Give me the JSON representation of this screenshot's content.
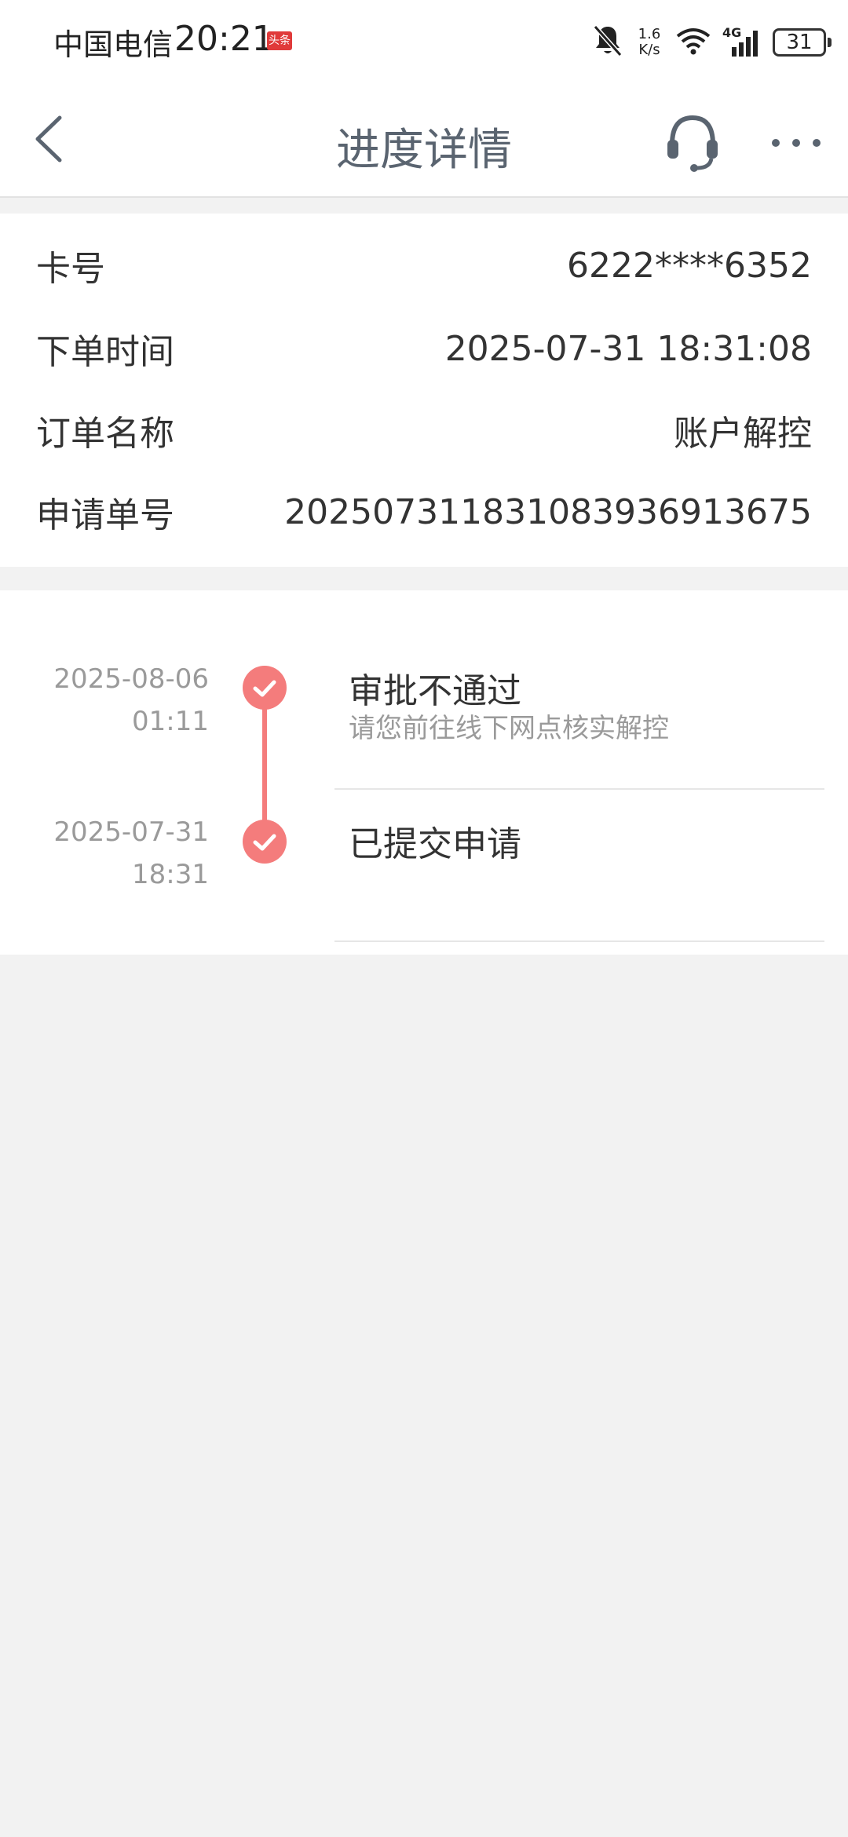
{
  "status_bar": {
    "carrier": "中国电信",
    "time": "20:21",
    "news_badge": "头条",
    "net_speed_value": "1.6",
    "net_speed_unit": "K/s",
    "network_type": "4G",
    "battery": "31"
  },
  "header": {
    "title": "进度详情",
    "back_icon": "chevron-left-icon",
    "support_icon": "headset-icon",
    "more_icon": "more-dots-icon"
  },
  "details": [
    {
      "label": "卡号",
      "value": "6222****6352"
    },
    {
      "label": "下单时间",
      "value": "2025-07-31 18:31:08"
    },
    {
      "label": "订单名称",
      "value": "账户解控"
    },
    {
      "label": "申请单号",
      "value": "202507311831083936913675"
    }
  ],
  "timeline": [
    {
      "date": "2025-08-06",
      "time": "01:11",
      "title": "审批不通过",
      "desc": "请您前往线下网点核实解控"
    },
    {
      "date": "2025-07-31",
      "time": "18:31",
      "title": "已提交申请",
      "desc": ""
    }
  ],
  "colors": {
    "accent": "#f47c7c",
    "title": "#5a6470",
    "background": "#f2f2f2"
  }
}
